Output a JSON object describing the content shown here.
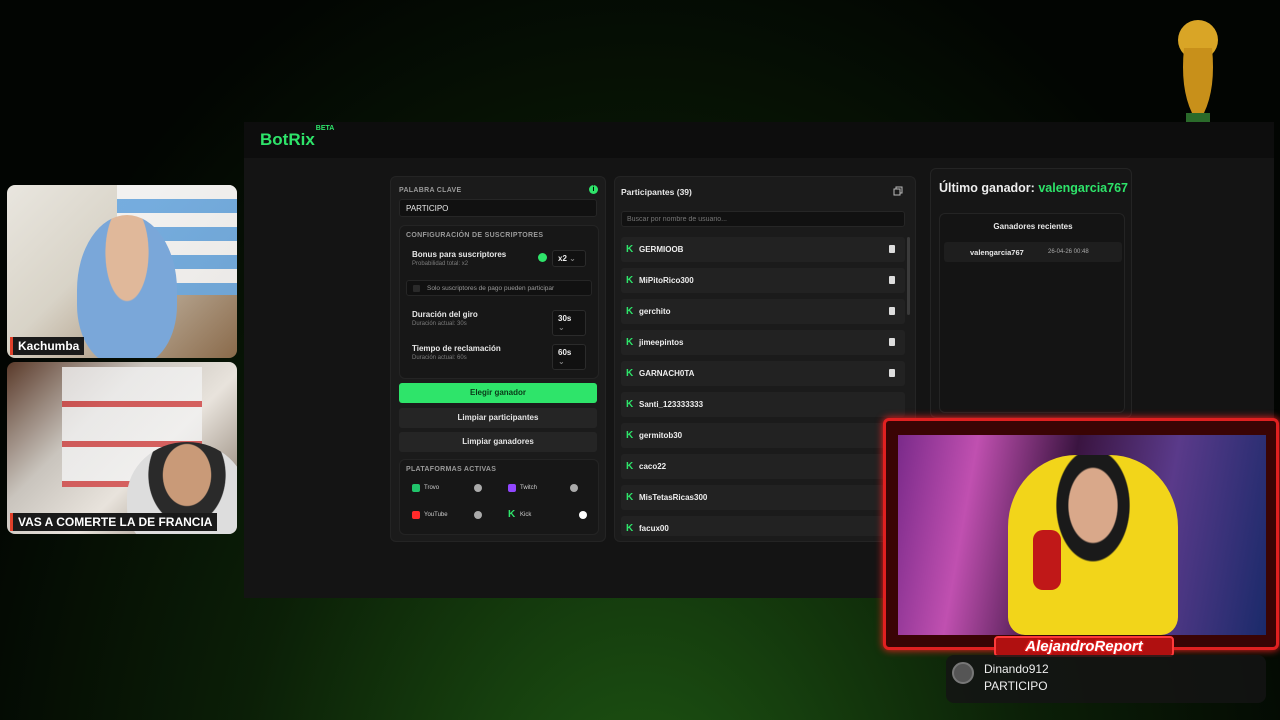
{
  "webcams": [
    {
      "label": "Kachumba"
    },
    {
      "label": "VAS A COMERTE LA DE FRANCIA"
    }
  ],
  "botrix": {
    "logo": "BotRix",
    "logo_badge": "BETA",
    "keyword_section": {
      "label": "PALABRA CLAVE",
      "info": "i",
      "value": "PARTICIPO"
    },
    "subscribers_config": {
      "label": "CONFIGURACIÓN DE SUSCRIPTORES",
      "bonus_label": "Bonus para suscriptores",
      "bonus_sub": "Probabilidad total: x2",
      "bonus_value": "x2",
      "paid_only_label": "Solo suscriptores de pago pueden participar",
      "spin_label": "Duración del giro",
      "spin_sub": "Duración actual: 30s",
      "spin_value": "30s",
      "claim_label": "Tiempo de reclamación",
      "claim_sub": "Duración actual: 60s",
      "claim_value": "60s"
    },
    "buttons": {
      "pick_winner": "Elegir ganador",
      "clear_participants": "Limpiar participantes",
      "clear_winners": "Limpiar ganadores"
    },
    "platforms": {
      "label": "PLATAFORMAS ACTIVAS",
      "items": [
        {
          "name": "Trovo",
          "on": false,
          "color": "#21c46b"
        },
        {
          "name": "Twitch",
          "on": false,
          "color": "#9146ff"
        },
        {
          "name": "YouTube",
          "on": false,
          "color": "#ff2a2a"
        },
        {
          "name": "Kick",
          "on": true,
          "color": "#2ee46a"
        }
      ]
    },
    "participants": {
      "title": "Participantes (39)",
      "search_placeholder": "Buscar por nombre de usuario...",
      "list": [
        "GERMIOOB",
        "MiPitoRico300",
        "gerchito",
        "jimeepintos",
        "GARNACH0TA",
        "Santi_123333333",
        "germitob30",
        "caco22",
        "MisTetasRicas300",
        "facux00"
      ]
    },
    "last_winner": {
      "label": "Último ganador:",
      "name": "valengarcia767",
      "recent_title": "Ganadores recientes",
      "recent": [
        {
          "name": "valengarcia767",
          "time": "26-04-26 00:48"
        }
      ]
    },
    "accent": "#2ee46a"
  },
  "streamer_overlay": {
    "brand": "AlejandroReport"
  },
  "chat_message": {
    "user": "Dinando912",
    "message": "PARTICIPO"
  }
}
